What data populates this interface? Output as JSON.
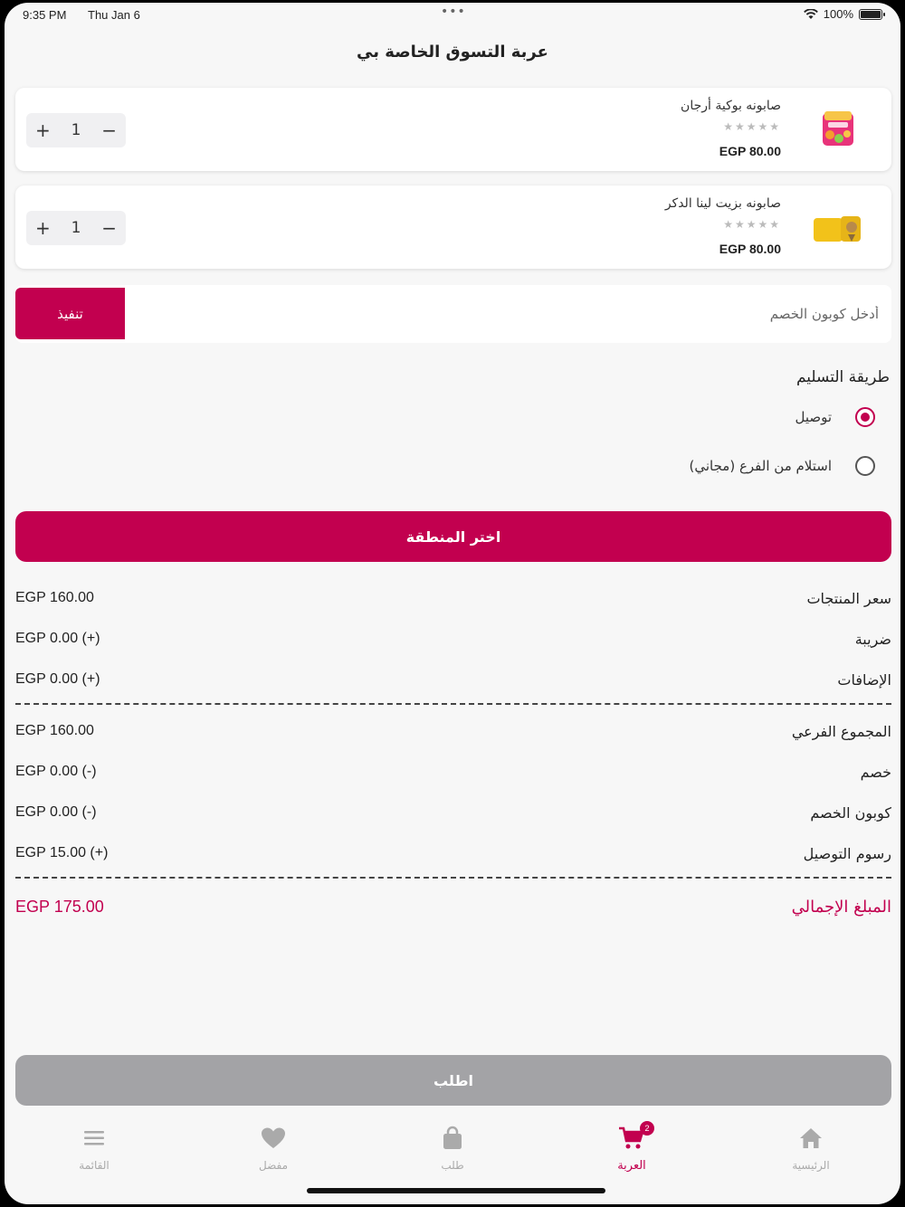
{
  "status_bar": {
    "time": "9:35 PM",
    "date": "Thu Jan 6",
    "battery": "100%"
  },
  "page_title": "عربة التسوق الخاصة بي",
  "cart_items": [
    {
      "name": "صابونه بوكية أرجان",
      "stars": "★★★★★",
      "price": "EGP 80.00",
      "qty": "1",
      "plus": "+",
      "minus": "−"
    },
    {
      "name": "صابونه بزيت لينا الدكر",
      "stars": "★★★★★",
      "price": "EGP 80.00",
      "qty": "1",
      "plus": "+",
      "minus": "−"
    }
  ],
  "coupon": {
    "placeholder": "أدخل كوبون الخصم",
    "apply_label": "تنفيذ"
  },
  "delivery": {
    "title": "طريقة التسليم",
    "options": [
      {
        "label": "توصيل",
        "selected": true
      },
      {
        "label": "استلام من الفرع  (مجاني)",
        "selected": false
      }
    ]
  },
  "choose_area_label": "اختر المنطقة",
  "summary": {
    "products_price": {
      "label": "سعر المنتجات",
      "value": "EGP 160.00"
    },
    "tax": {
      "label": "ضريبة",
      "value": "EGP 0.00 (+)"
    },
    "addons": {
      "label": "الإضافات",
      "value": "EGP 0.00 (+)"
    },
    "subtotal": {
      "label": "المجموع الفرعي",
      "value": "EGP 160.00"
    },
    "discount": {
      "label": "خصم",
      "value": "EGP 0.00 (-)"
    },
    "coupon_discount": {
      "label": "كوبون الخصم",
      "value": "EGP 0.00 (-)"
    },
    "delivery_fee": {
      "label": "رسوم التوصيل",
      "value": "EGP 15.00 (+)"
    },
    "total": {
      "label": "المبلغ الإجمالي",
      "value": "EGP 175.00"
    }
  },
  "order_button_label": "اطلب",
  "tab_bar": {
    "menu": "القائمة",
    "favorites": "مفضل",
    "orders": "طلب",
    "cart": "العربة",
    "cart_badge": "2",
    "home": "الرئيسية"
  },
  "colors": {
    "accent": "#c2004f",
    "disabled": "#a3a3a6",
    "background": "#f7f7f7"
  }
}
